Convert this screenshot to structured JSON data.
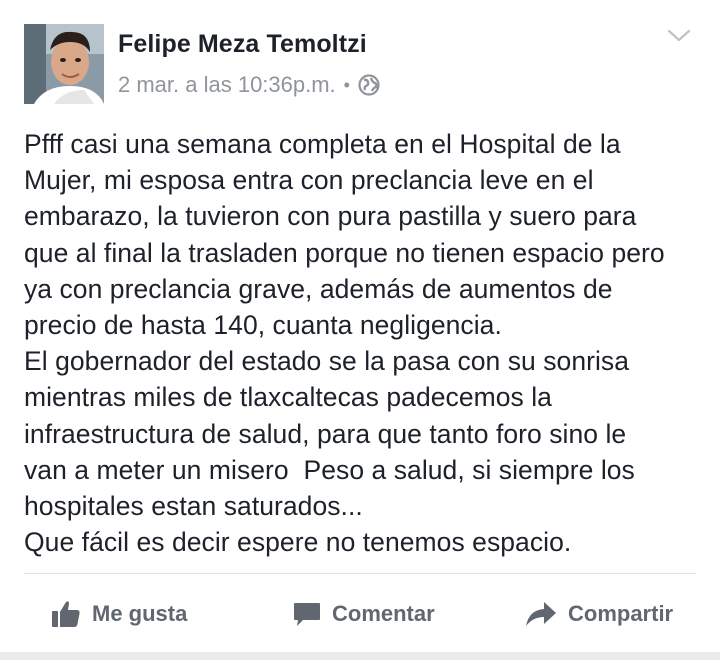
{
  "post": {
    "author_name": "Felipe Meza Temoltzi",
    "timestamp": "2 mar. a las 10:36p.m.",
    "separator": "•",
    "privacy_icon": "globe-icon",
    "options_icon": "chevron-down-icon",
    "text_lines": [
      "Pfff casi una semana completa en el Hospital de la",
      "Mujer, mi esposa entra con preclancia leve en el",
      "embarazo, la tuvieron con pura pastilla y suero para",
      "que al final la trasladen porque no tienen espacio pero",
      "ya con preclancia grave, además de aumentos de",
      "precio de hasta 140, cuanta negligencia.",
      "El gobernador del estado se la pasa con su sonrisa",
      "mientras miles de tlaxcaltecas padecemos la",
      "infraestructura de salud, para que tanto foro sino le",
      "van a meter un misero  Peso a salud, si siempre los",
      "hospitales estan saturados...",
      "Que fácil es decir espere no tenemos espacio."
    ]
  },
  "actions": {
    "like_label": "Me gusta",
    "like_icon": "thumbs-up-icon",
    "comment_label": "Comentar",
    "comment_icon": "comment-icon",
    "share_label": "Compartir",
    "share_icon": "share-arrow-icon"
  },
  "colors": {
    "text": "#1d2129",
    "meta": "#90949c",
    "action": "#606770",
    "divider": "#dddfe2"
  }
}
